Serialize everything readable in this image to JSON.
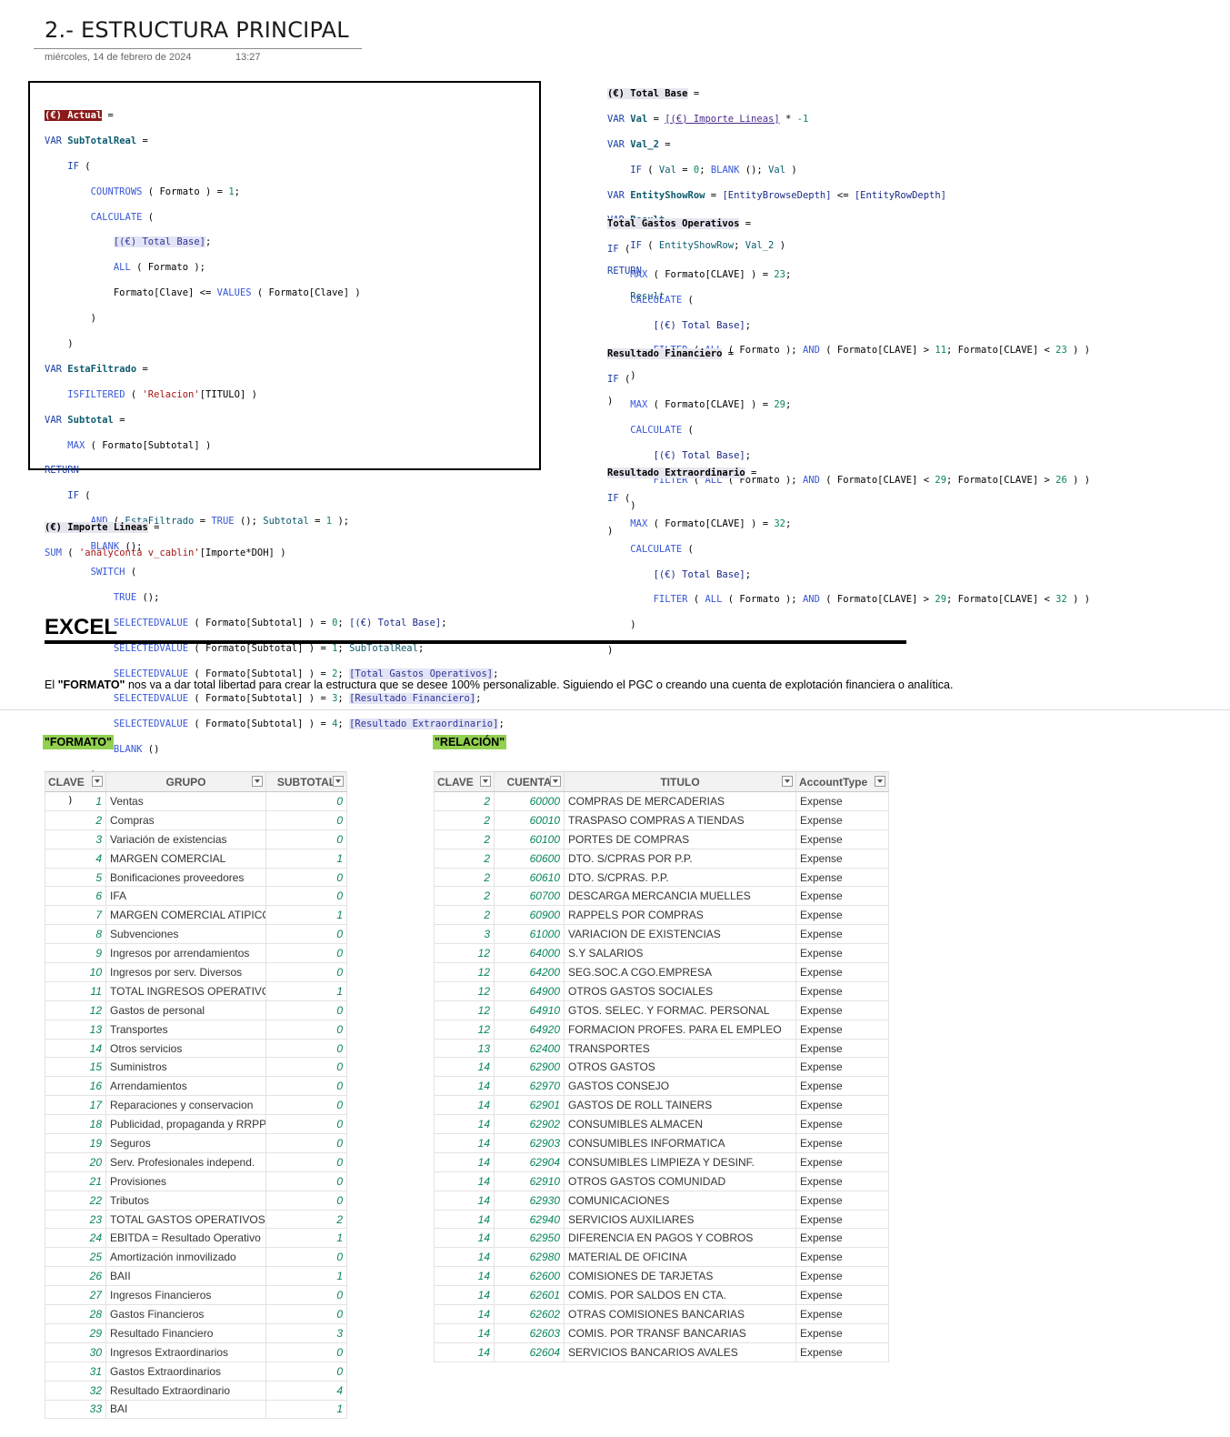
{
  "header": {
    "title": "2.- ESTRUCTURA PRINCIPAL",
    "date": "miércoles, 14 de febrero de 2024",
    "time": "13:27"
  },
  "code": {
    "actual_name": "(€) Actual",
    "importe_name": "(€) Importe Lineas",
    "importe_body": "SUM ( 'analyconta v_cablin'[Importe*DOH] )",
    "total_base_name": "(€) Total Base",
    "gastos_name": "Total Gastos Operativos",
    "financiero_name": "Resultado Financiero",
    "extra_name": "Resultado Extraordinario"
  },
  "excel": {
    "heading": "EXCEL",
    "desc_prefix": "El ",
    "desc_bold": "\"FORMATO\"",
    "desc_rest": " nos va a dar total libertad para crear la estructura que se desee 100% personalizable. Siguiendo el PGC o creando una cuenta de explotación financiera o analítica."
  },
  "formato": {
    "label": "\"FORMATO\"",
    "headers": [
      "CLAVE",
      "GRUPO",
      "SUBTOTAL"
    ],
    "rows": [
      [
        "1",
        "Ventas",
        "0"
      ],
      [
        "2",
        "Compras",
        "0"
      ],
      [
        "3",
        "Variación de existencias",
        "0"
      ],
      [
        "4",
        "MARGEN COMERCIAL",
        "1"
      ],
      [
        "5",
        "Bonificaciones proveedores",
        "0"
      ],
      [
        "6",
        "IFA",
        "0"
      ],
      [
        "7",
        "MARGEN COMERCIAL ATIPICOS",
        "1"
      ],
      [
        "8",
        "Subvenciones",
        "0"
      ],
      [
        "9",
        "Ingresos por arrendamientos",
        "0"
      ],
      [
        "10",
        "Ingresos por serv. Diversos",
        "0"
      ],
      [
        "11",
        "TOTAL INGRESOS OPERATIVOS",
        "1"
      ],
      [
        "12",
        "Gastos de personal",
        "0"
      ],
      [
        "13",
        "Transportes",
        "0"
      ],
      [
        "14",
        "Otros servicios",
        "0"
      ],
      [
        "15",
        "Suministros",
        "0"
      ],
      [
        "16",
        "Arrendamientos",
        "0"
      ],
      [
        "17",
        "Reparaciones y conservacion",
        "0"
      ],
      [
        "18",
        "Publicidad, propaganda y RRPP",
        "0"
      ],
      [
        "19",
        "Seguros",
        "0"
      ],
      [
        "20",
        "Serv. Profesionales independ.",
        "0"
      ],
      [
        "21",
        "Provisiones",
        "0"
      ],
      [
        "22",
        "Tributos",
        "0"
      ],
      [
        "23",
        "TOTAL GASTOS OPERATIVOS",
        "2"
      ],
      [
        "24",
        "EBITDA = Resultado Operativo",
        "1"
      ],
      [
        "25",
        "Amortización inmovilizado",
        "0"
      ],
      [
        "26",
        "BAII",
        "1"
      ],
      [
        "27",
        "Ingresos Financieros",
        "0"
      ],
      [
        "28",
        "Gastos Financieros",
        "0"
      ],
      [
        "29",
        "Resultado Financiero",
        "3"
      ],
      [
        "30",
        "Ingresos Extraordinarios",
        "0"
      ],
      [
        "31",
        "Gastos Extraordinarios",
        "0"
      ],
      [
        "32",
        "Resultado Extraordinario",
        "4"
      ],
      [
        "33",
        "BAI",
        "1"
      ]
    ]
  },
  "relacion": {
    "label": "\"RELACIÓN\"",
    "headers": [
      "CLAVE",
      "CUENTA",
      "TITULO",
      "AccountType"
    ],
    "rows": [
      [
        "2",
        "60000",
        "COMPRAS DE MERCADERIAS",
        "Expense"
      ],
      [
        "2",
        "60010",
        "TRASPASO COMPRAS A TIENDAS",
        "Expense"
      ],
      [
        "2",
        "60100",
        "PORTES DE COMPRAS",
        "Expense"
      ],
      [
        "2",
        "60600",
        "DTO. S/CPRAS POR P.P.",
        "Expense"
      ],
      [
        "2",
        "60610",
        "DTO. S/CPRAS. P.P.",
        "Expense"
      ],
      [
        "2",
        "60700",
        "DESCARGA MERCANCIA MUELLES",
        "Expense"
      ],
      [
        "2",
        "60900",
        "RAPPELS POR COMPRAS",
        "Expense"
      ],
      [
        "3",
        "61000",
        "VARIACION DE EXISTENCIAS",
        "Expense"
      ],
      [
        "12",
        "64000",
        "S.Y SALARIOS",
        "Expense"
      ],
      [
        "12",
        "64200",
        "SEG.SOC.A CGO.EMPRESA",
        "Expense"
      ],
      [
        "12",
        "64900",
        "OTROS GASTOS SOCIALES",
        "Expense"
      ],
      [
        "12",
        "64910",
        "GTOS. SELEC. Y FORMAC. PERSONAL",
        "Expense"
      ],
      [
        "12",
        "64920",
        "FORMACION PROFES. PARA EL EMPLEO",
        "Expense"
      ],
      [
        "13",
        "62400",
        "TRANSPORTES",
        "Expense"
      ],
      [
        "14",
        "62900",
        "OTROS GASTOS",
        "Expense"
      ],
      [
        "14",
        "62970",
        "GASTOS CONSEJO",
        "Expense"
      ],
      [
        "14",
        "62901",
        "GASTOS DE ROLL TAINERS",
        "Expense"
      ],
      [
        "14",
        "62902",
        "CONSUMIBLES ALMACEN",
        "Expense"
      ],
      [
        "14",
        "62903",
        "CONSUMIBLES INFORMATICA",
        "Expense"
      ],
      [
        "14",
        "62904",
        "CONSUMIBLES LIMPIEZA Y DESINF.",
        "Expense"
      ],
      [
        "14",
        "62910",
        "OTROS GASTOS COMUNIDAD",
        "Expense"
      ],
      [
        "14",
        "62930",
        "COMUNICACIONES",
        "Expense"
      ],
      [
        "14",
        "62940",
        "SERVICIOS AUXILIARES",
        "Expense"
      ],
      [
        "14",
        "62950",
        "DIFERENCIA EN PAGOS Y COBROS",
        "Expense"
      ],
      [
        "14",
        "62980",
        "MATERIAL DE OFICINA",
        "Expense"
      ],
      [
        "14",
        "62600",
        "COMISIONES DE TARJETAS",
        "Expense"
      ],
      [
        "14",
        "62601",
        "COMIS. POR SALDOS EN CTA.",
        "Expense"
      ],
      [
        "14",
        "62602",
        "OTRAS COMISIONES BANCARIAS",
        "Expense"
      ],
      [
        "14",
        "62603",
        "COMIS. POR TRANSF BANCARIAS",
        "Expense"
      ],
      [
        "14",
        "62604",
        "SERVICIOS BANCARIOS AVALES",
        "Expense"
      ]
    ]
  }
}
